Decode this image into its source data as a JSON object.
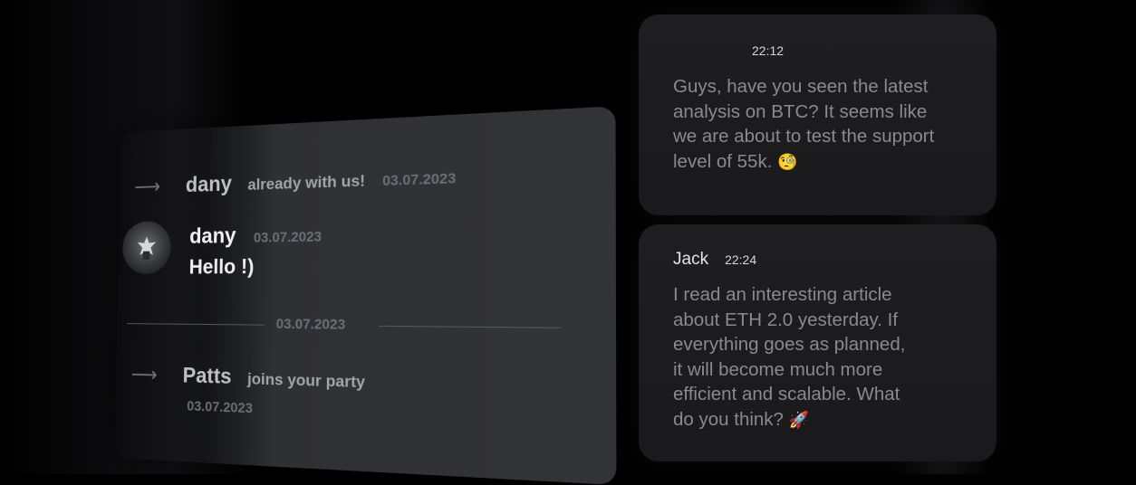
{
  "left_panel": {
    "events": [
      {
        "user": "dany",
        "action": "already with us!",
        "date": "03.07.2023"
      },
      {
        "user": "Patts",
        "action": "joins your party",
        "date": "03.07.2023"
      }
    ],
    "message": {
      "user": "dany",
      "date": "03.07.2023",
      "text": "Hello !)"
    },
    "divider_date": "03.07.2023"
  },
  "right_panel": {
    "messages": [
      {
        "user": "",
        "time": "22:12",
        "lines": [
          "Guys, have you seen the latest",
          "analysis on BTC? It seems like",
          "we are about to test the support",
          "level of 55k."
        ],
        "emoji": "🧐",
        "emoji_name": "monocle-face-emoji"
      },
      {
        "user": "Jack",
        "time": "22:24",
        "lines": [
          "I read an interesting article",
          "about ETH 2.0 yesterday. If",
          "everything goes as planned,",
          "it will become much more",
          "efficient and scalable. What",
          "do you think?"
        ],
        "emoji": "🚀",
        "emoji_name": "rocket-emoji"
      }
    ]
  }
}
